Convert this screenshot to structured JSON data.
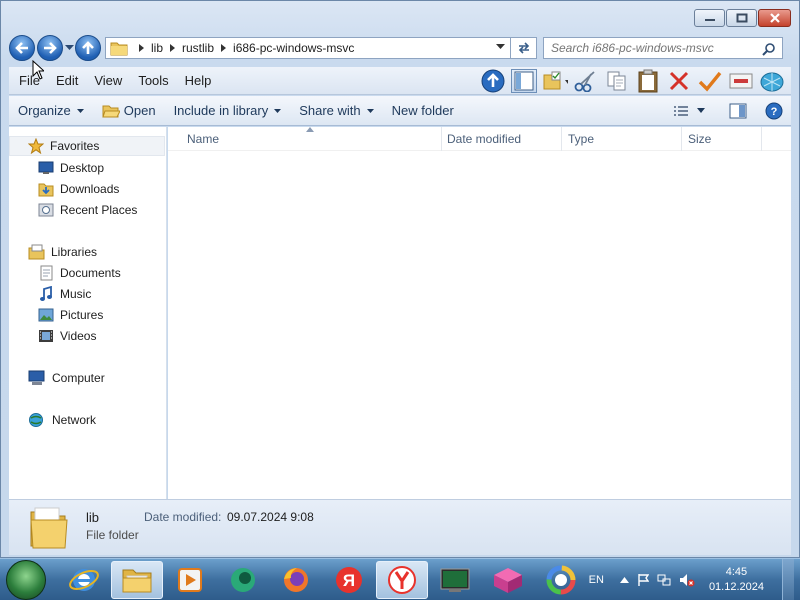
{
  "window": {
    "title": ""
  },
  "address": {
    "crumbs": [
      "lib",
      "rustlib",
      "i686-pc-windows-msvc"
    ]
  },
  "search": {
    "placeholder": "Search i686-pc-windows-msvc"
  },
  "menu": {
    "items": [
      "File",
      "Edit",
      "View",
      "Tools",
      "Help"
    ]
  },
  "command_bar": {
    "organize": "Organize",
    "open": "Open",
    "include_in_library": "Include in library",
    "share_with": "Share with",
    "new_folder": "New folder"
  },
  "nav_pane": {
    "favorites": "Favorites",
    "desktop": "Desktop",
    "downloads": "Downloads",
    "recent_places": "Recent Places",
    "libraries": "Libraries",
    "documents": "Documents",
    "music": "Music",
    "pictures": "Pictures",
    "videos": "Videos",
    "computer": "Computer",
    "network": "Network"
  },
  "columns": {
    "name": "Name",
    "date_modified": "Date modified",
    "type": "Type",
    "size": "Size"
  },
  "details": {
    "name": "lib",
    "type": "File folder",
    "date_modified_label": "Date modified:",
    "date_modified_value": "09.07.2024 9:08"
  },
  "taskbar": {
    "language": "EN",
    "time": "4:45",
    "date": "01.12.2024"
  },
  "icons": {
    "back": "back-arrow-icon",
    "forward": "forward-arrow-icon",
    "up": "up-arrow-icon",
    "search": "magnifier-icon",
    "refresh": "refresh-icon"
  },
  "colors": {
    "accent": "#1f5fb3",
    "window_bg": "#c9daee",
    "taskbar": "#3e6f9f",
    "close_button": "#c4422c"
  }
}
